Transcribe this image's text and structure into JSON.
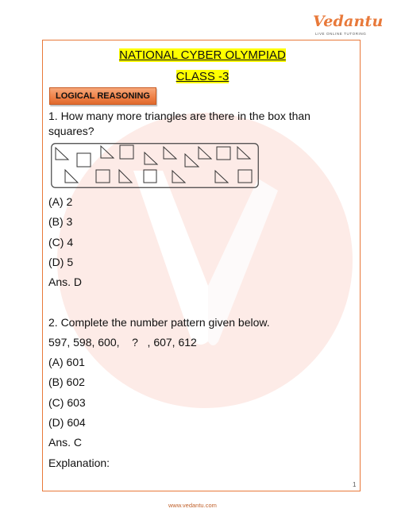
{
  "header": {
    "logo_text": "Vedantu",
    "logo_tagline": "LIVE ONLINE TUTORING"
  },
  "title": "NATIONAL CYBER OLYMPIAD",
  "subtitle": "CLASS -3",
  "section_tab": "LOGICAL REASONING",
  "questions": [
    {
      "text": "1. How many more triangles are there in the box than squares?",
      "figure": {
        "description": "box of triangles and squares",
        "top_row": [
          "triangle",
          "square",
          "triangle",
          "square",
          "triangle",
          "triangle",
          "triangle",
          "triangle",
          "square",
          "triangle"
        ],
        "bottom_row": [
          "triangle",
          "square",
          "triangle",
          "square",
          "triangle",
          "triangle",
          "square"
        ]
      },
      "options": [
        "(A) 2",
        "(B) 3",
        "(C) 4",
        "(D) 5"
      ],
      "answer": "Ans. D"
    },
    {
      "text": "2. Complete the number pattern given below.",
      "pattern": "597, 598, 600,    ?   , 607, 612",
      "options": [
        "(A) 601",
        "(B) 602",
        "(C) 603",
        "(D) 604"
      ],
      "answer": "Ans. C",
      "explanation_label": "Explanation:"
    }
  ],
  "page_number": "1",
  "footer_url": "www.vedantu.com",
  "colors": {
    "accent": "#e8793a",
    "highlight": "#ffff00",
    "watermark": "#fdeae6"
  }
}
